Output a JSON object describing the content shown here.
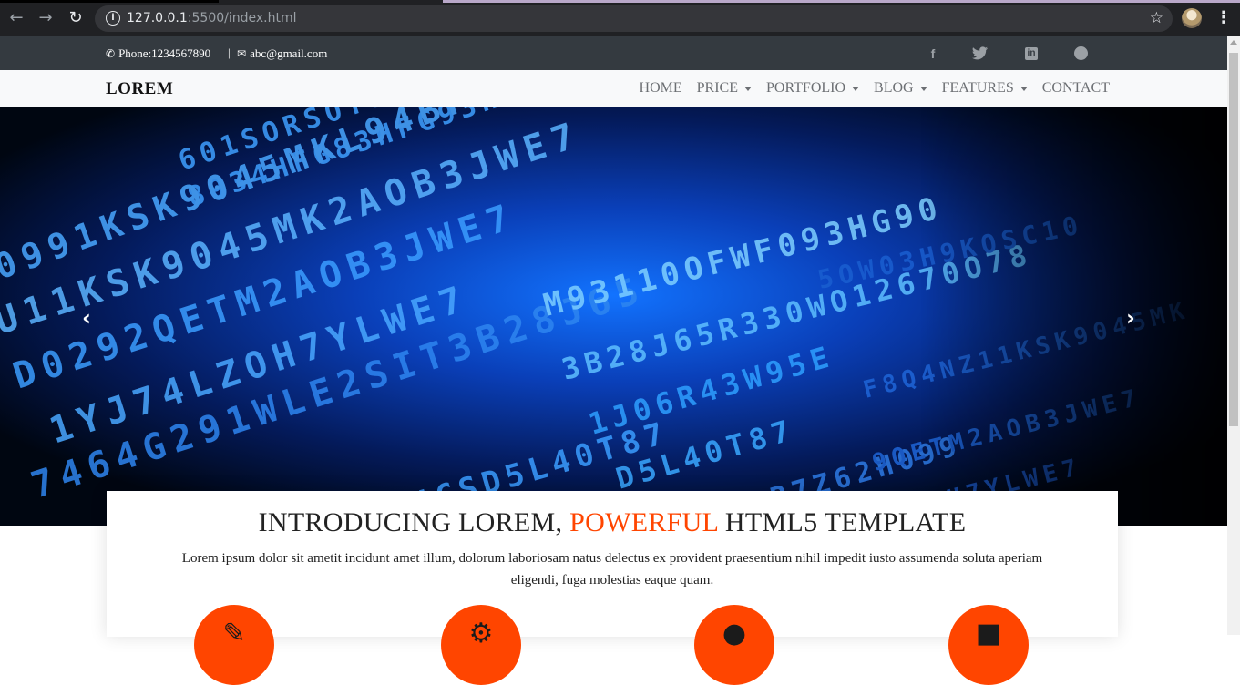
{
  "browser": {
    "url_host": "127.0.0.1",
    "url_rest": ":5500/index.html",
    "back_icon": "arrow-left-icon",
    "forward_icon": "arrow-right-icon",
    "reload_icon": "reload-icon",
    "bookmark_icon": "star-icon"
  },
  "topbar": {
    "phone": "Phone:1234567890",
    "separator": "|",
    "email": "abc@gmail.com",
    "social": [
      "facebook-icon",
      "twitter-icon",
      "linkedin-icon",
      "github-icon"
    ]
  },
  "navbar": {
    "brand": "LOREM",
    "links": [
      {
        "label": "HOME",
        "dropdown": false
      },
      {
        "label": "PRICE",
        "dropdown": true
      },
      {
        "label": "PORTFOLIO",
        "dropdown": true
      },
      {
        "label": "BLOG",
        "dropdown": true
      },
      {
        "label": "FEATURES",
        "dropdown": true
      },
      {
        "label": "CONTACT",
        "dropdown": false
      }
    ]
  },
  "hero": {
    "prev_label": "‹",
    "next_label": "›"
  },
  "intro": {
    "title_part1": "INTRODUCING LOREM, ",
    "title_accent": "POWERFUL",
    "title_part2": " HTML5 TEMPLATE",
    "text": "Lorem ipsum dolor sit ametit incidunt amet illum, dolorum laboriosam natus delectus ex provident praesentium nihil impedit iusto assumenda soluta aperiam eligendi, fuga molestias eaque quam.",
    "accent_color": "#ff4500",
    "feature_icons": [
      "feature-icon-1",
      "feature-icon-2",
      "feature-icon-3",
      "feature-icon-4"
    ]
  }
}
